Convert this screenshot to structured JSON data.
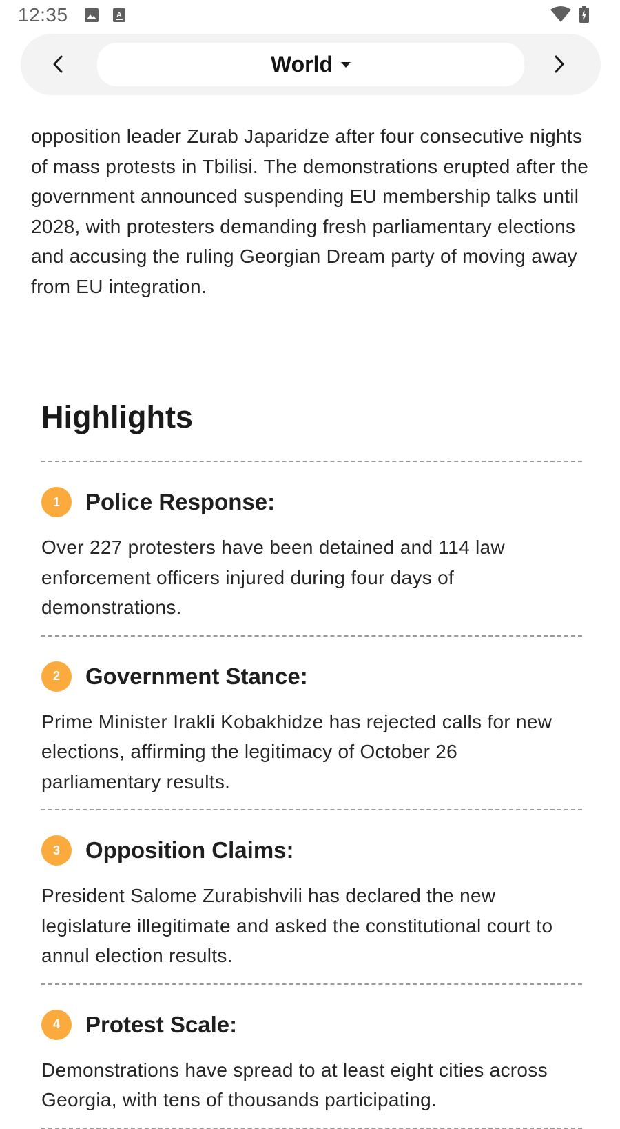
{
  "status_bar": {
    "time": "12:35",
    "left_icons": [
      "image-icon",
      "keyboard-a-icon"
    ],
    "right_icons": [
      "wifi-icon",
      "battery-charging-icon"
    ]
  },
  "nav": {
    "title": "World",
    "prev_icon": "chevron-left-icon",
    "next_icon": "chevron-right-icon",
    "dropdown_icon": "caret-down-icon"
  },
  "article": {
    "text": "opposition leader Zurab Japaridze after four consecutive nights of mass protests in Tbilisi. The demonstrations erupted after the government announced suspending EU membership talks until 2028, with protesters demanding fresh parliamentary elections and accusing the ruling Georgian Dream party of moving away from EU integration."
  },
  "highlights": {
    "title": "Highlights",
    "accent_color": "#fbab3d",
    "items": [
      {
        "number": "1",
        "title": "Police Response:",
        "body": "Over 227 protesters have been detained and 114 law enforcement officers injured during four days of demonstrations."
      },
      {
        "number": "2",
        "title": "Government Stance:",
        "body": "Prime Minister Irakli Kobakhidze has rejected calls for new elections, affirming the legitimacy of October 26 parliamentary results."
      },
      {
        "number": "3",
        "title": "Opposition Claims:",
        "body": "President Salome Zurabishvili has declared the new legislature illegitimate and asked the constitutional court to annul election results."
      },
      {
        "number": "4",
        "title": "Protest Scale:",
        "body": "Demonstrations have spread to at least eight cities across Georgia, with tens of thousands participating."
      }
    ]
  }
}
